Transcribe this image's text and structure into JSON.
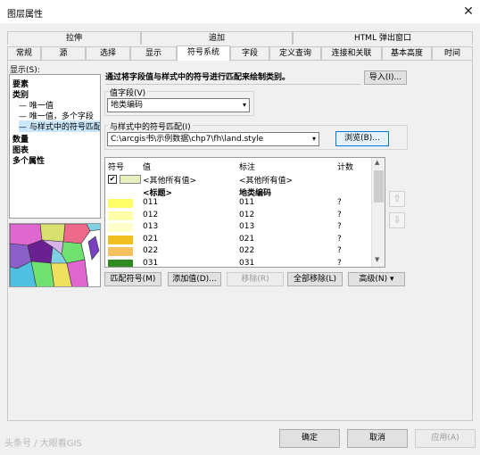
{
  "window": {
    "title": "图层属性",
    "close": "✕"
  },
  "tabs_row1": [
    "拉伸",
    "追加",
    "HTML 弹出窗口"
  ],
  "tabs_row2": [
    "常规",
    "源",
    "选择",
    "显示",
    "符号系统",
    "字段",
    "定义查询",
    "连接和关联",
    "基本高度",
    "时间"
  ],
  "show_label": "显示(S):",
  "tree": [
    "要素",
    "类别",
    "唯一值",
    "唯一值，多个字段",
    "与样式中的符号匹配",
    "数量",
    "图表",
    "多个属性"
  ],
  "description": "通过将字段值与样式中的符号进行匹配来绘制类别。",
  "import_label": "导入(I)...",
  "value_field": {
    "label": "值字段(V)",
    "value": "地类编码"
  },
  "style_match": {
    "label": "与样式中的符号匹配(I)",
    "value": "C:\\arcgis书\\示例数据\\chp7\\fh\\land.style",
    "browse": "浏览(B)..."
  },
  "grid": {
    "headers": [
      "符号",
      "值",
      "标注",
      "计数"
    ],
    "rows": [
      {
        "value": "<其他所有值>",
        "label": "<其他所有值>",
        "count": "",
        "color": "#e8f0c0",
        "bold": false,
        "checked": true
      },
      {
        "value": "<标题>",
        "label": "地类编码",
        "count": "",
        "color": "",
        "bold": true,
        "checked": false
      },
      {
        "value": "011",
        "label": "011",
        "count": "?",
        "color": "#ffff66",
        "bold": false,
        "checked": false
      },
      {
        "value": "012",
        "label": "012",
        "count": "?",
        "color": "#ffffaa",
        "bold": false,
        "checked": false
      },
      {
        "value": "013",
        "label": "013",
        "count": "?",
        "color": "#ffffcc",
        "bold": false,
        "checked": false
      },
      {
        "value": "021",
        "label": "021",
        "count": "?",
        "color": "#f0c020",
        "bold": false,
        "checked": false
      },
      {
        "value": "022",
        "label": "022",
        "count": "?",
        "color": "#f5c060",
        "bold": false,
        "checked": false
      },
      {
        "value": "031",
        "label": "031",
        "count": "?",
        "color": "#2e8b20",
        "bold": false,
        "checked": false
      }
    ]
  },
  "buttons": {
    "match": "匹配符号(M)",
    "add": "添加值(D)...",
    "remove": "移除(R)",
    "remove_all": "全部移除(L)",
    "advanced": "高级(N)",
    "ok": "确定",
    "cancel": "取消",
    "apply": "应用(A)"
  },
  "watermark": "头条号 / 大眼看GIS",
  "colors": {
    "accent": "#0078d7"
  }
}
